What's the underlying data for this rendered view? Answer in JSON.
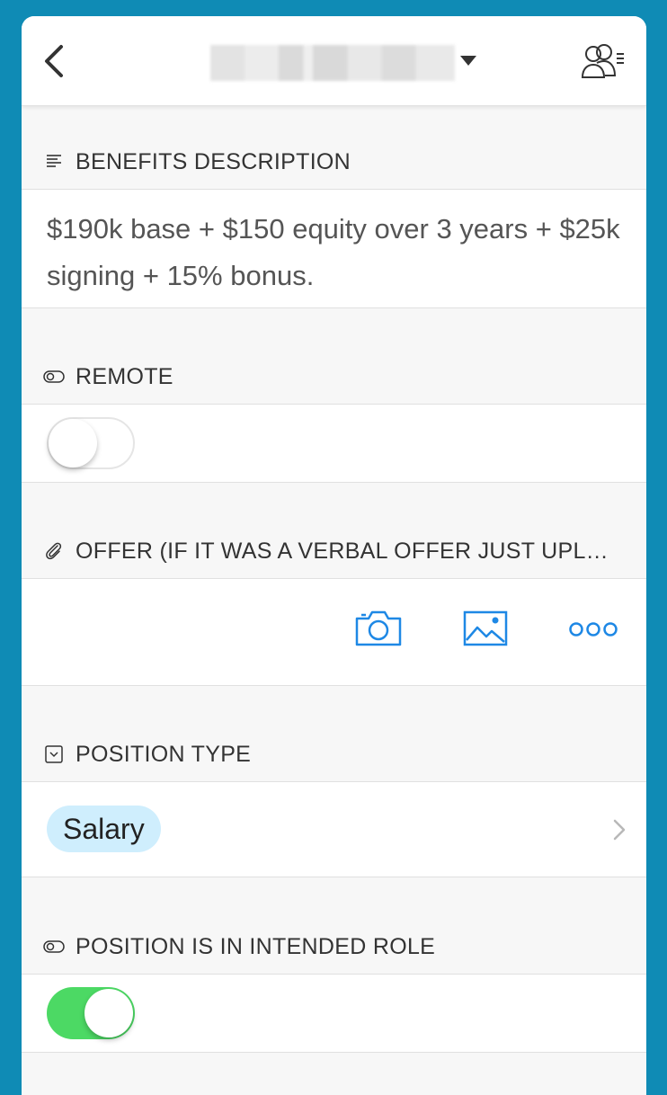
{
  "header": {
    "title": "",
    "back_icon": "chevron-left-icon",
    "people_icon": "people-list-icon"
  },
  "benefits": {
    "label": "BENEFITS DESCRIPTION",
    "icon": "text-align-icon",
    "text": "$190k base + $150 equity over 3 years + $25k signing + 15% bonus."
  },
  "remote": {
    "label": "REMOTE",
    "icon": "toggle-icon",
    "checked": false
  },
  "offer": {
    "label": "OFFER (IF IT WAS A VERBAL OFFER JUST UPL…",
    "icon": "paperclip-icon",
    "actions": [
      "camera-icon",
      "image-icon",
      "more-icon"
    ]
  },
  "position_type": {
    "label": "POSITION TYPE",
    "icon": "dropdown-box-icon",
    "value": "Salary"
  },
  "intended_role": {
    "label": "POSITION IS IN INTENDED ROLE",
    "icon": "toggle-icon",
    "checked": true
  },
  "colors": {
    "frame": "#0f8bb5",
    "accent": "#1e88e5",
    "toggle_on": "#4cd964",
    "chip": "#cfeefd"
  }
}
